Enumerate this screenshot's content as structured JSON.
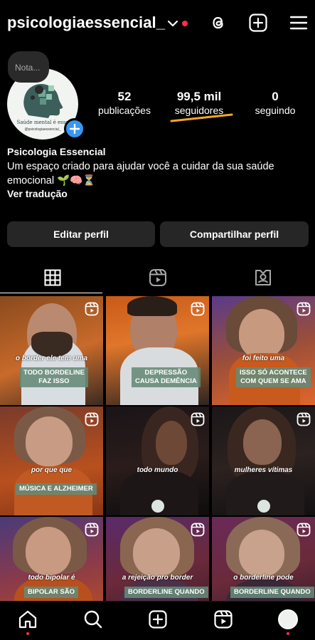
{
  "header": {
    "username": "psicologiaessencial_",
    "icons": [
      "chevron-down-icon",
      "threads-icon",
      "new-post-icon",
      "menu-icon"
    ]
  },
  "note": {
    "placeholder": "Nota..."
  },
  "avatar": {
    "line1": "Saúde mental é esse",
    "line2": "@psicologiaessencial_"
  },
  "stats": [
    {
      "value": "52",
      "label": "publicações"
    },
    {
      "value": "99,5 mil",
      "label": "seguidores"
    },
    {
      "value": "0",
      "label": "seguindo"
    }
  ],
  "profile": {
    "name": "Psicologia Essencial",
    "bio_line1": "Um espaço criado para ajudar você a cuidar da sua saúde",
    "bio_line2": "emocional 🌱🧠⏳",
    "translate": "Ver tradução"
  },
  "buttons": {
    "edit": "Editar perfil",
    "share": "Compartilhar perfil"
  },
  "tabs": [
    "grid-icon",
    "reels-icon",
    "tagged-icon"
  ],
  "posts": [
    {
      "italic": "o border ele tem uma",
      "caption": "TODO BORDELINE\nFAZ ISSO"
    },
    {
      "italic": "",
      "caption": "DEPRESSÃO\nCAUSA DEMÊNCIA"
    },
    {
      "italic": "foi feito uma",
      "caption": "ISSO SÓ ACONTECE\nCOM QUEM SE AMA"
    },
    {
      "italic": "por que que",
      "caption": "MÚSICA E ALZHEIMER"
    },
    {
      "italic": "todo mundo",
      "caption": ""
    },
    {
      "italic": "mulheres vítimas",
      "caption": ""
    },
    {
      "italic": "todo bipolar é",
      "caption": "BIPOLAR SÃO"
    },
    {
      "italic": "a rejeição pro border",
      "caption": "BORDERLINE QUANDO"
    },
    {
      "italic": "o borderline pode",
      "caption": "BORDERLINE QUANDO"
    }
  ],
  "bottom_nav": [
    "home-icon",
    "search-icon",
    "create-icon",
    "reels-icon",
    "profile-avatar"
  ],
  "colors": {
    "accent": "#3897f0",
    "notification": "#ff3040",
    "button_bg": "#262626",
    "highlight": "#f5a623"
  }
}
